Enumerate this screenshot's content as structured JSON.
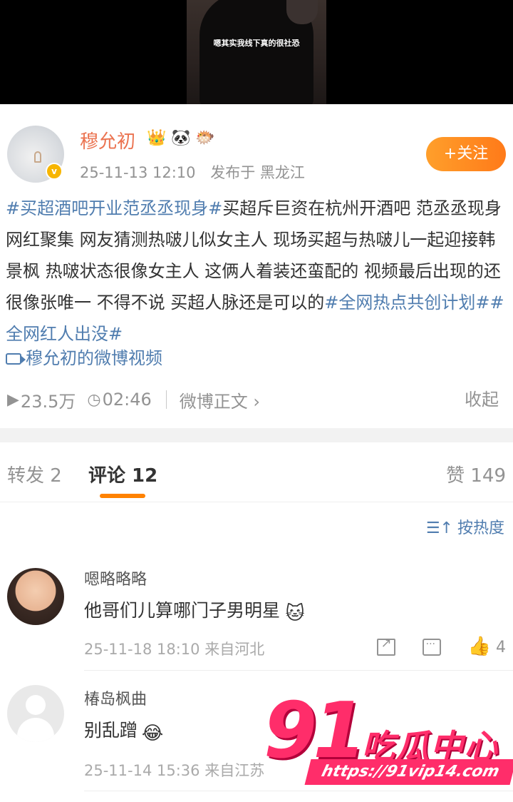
{
  "video": {
    "caption": "嗯其实我线下真的很社恐"
  },
  "author": {
    "name": "穆允初",
    "badges": [
      "👑",
      "🐼",
      "🐡"
    ],
    "time": "25-11-13 12:10",
    "location": "发布于 黑龙江",
    "follow_label": "+关注",
    "verified_mark": "v"
  },
  "post": {
    "hashtag1": "#买超酒吧开业范丞丞现身#",
    "body": "买超斥巨资在杭州开酒吧 范丞丞现身 网红聚集 网友猜测热啵儿似女主人  现场买超与热啵儿一起迎接韩景枫 热啵状态很像女主人 这俩人着装还蛮配的 视频最后出现的还很像张唯一 不得不说 买超人脉还是可以的",
    "hashtag2": "#全网热点共创计划#",
    "hashtag3": "#全网红人出没#",
    "video_link": "穆允初的微博视频"
  },
  "stats": {
    "views_icon": "▶",
    "views": "23.5万",
    "duration_icon": "◷",
    "duration": "02:46",
    "full_text": "微博正文 ›",
    "collapse": "收起"
  },
  "tabs": {
    "repost": "转发 2",
    "comments": "评论 12",
    "likes": "赞 149"
  },
  "sort": {
    "icon": "☰↑",
    "label": "按热度"
  },
  "comments": [
    {
      "name": "嗯略略略",
      "text": "他哥们儿算哪门子男明星",
      "emoji": "🐱",
      "time": "25-11-18 18:10 来自河北",
      "like_icon": "👍",
      "likes": "4"
    },
    {
      "name": "椿岛枫曲",
      "text": "别乱蹭",
      "emoji": "😂",
      "time": "25-11-14 15:36 来自江苏"
    }
  ],
  "watermark": {
    "number": "91",
    "name": "吃瓜中心",
    "url": "https://91vip14.com"
  },
  "colors": {
    "accent": "#ff8200",
    "link": "#507daf",
    "username": "#eb7350",
    "watermark": "#ff2d6a"
  }
}
